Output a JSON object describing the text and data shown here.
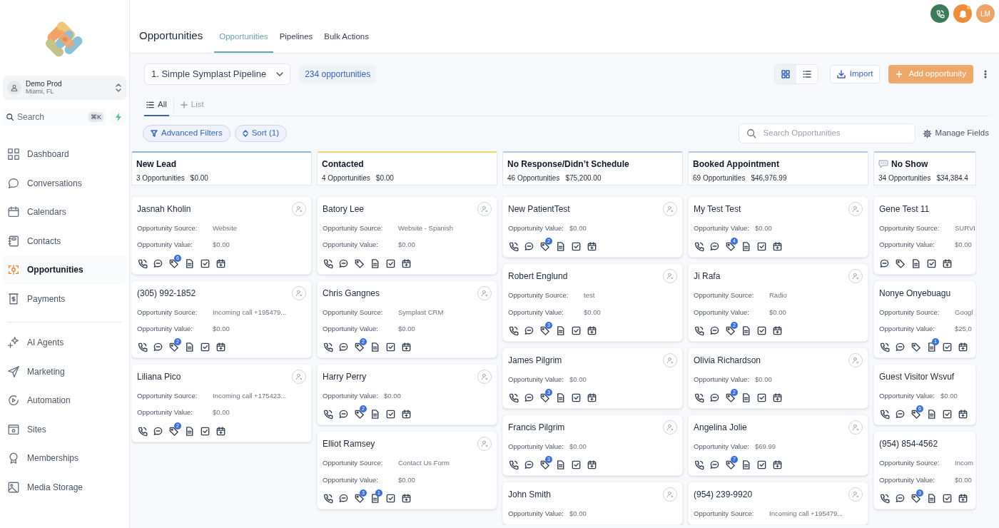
{
  "sidebar": {
    "account": {
      "name": "Demo Prod",
      "location": "Miami, FL"
    },
    "search": {
      "placeholder": "Search",
      "shortcut": "⌘K"
    },
    "nav_groups": [
      [
        {
          "label": "Dashboard",
          "selected": false
        },
        {
          "label": "Conversations",
          "selected": false
        },
        {
          "label": "Calendars",
          "selected": false
        },
        {
          "label": "Contacts",
          "selected": false
        },
        {
          "label": "Opportunities",
          "selected": true
        },
        {
          "label": "Payments",
          "selected": false
        }
      ],
      [
        {
          "label": "AI Agents",
          "selected": false
        },
        {
          "label": "Marketing",
          "selected": false
        },
        {
          "label": "Automation",
          "selected": false
        },
        {
          "label": "Sites",
          "selected": false
        },
        {
          "label": "Memberships",
          "selected": false
        },
        {
          "label": "Media Storage",
          "selected": false
        }
      ]
    ]
  },
  "topbar": {
    "avatar": "LM",
    "notification_dot": true
  },
  "header": {
    "title": "Opportunities",
    "tabs": [
      {
        "label": "Opportunities",
        "selected": true
      },
      {
        "label": "Pipelines",
        "selected": false
      },
      {
        "label": "Bulk Actions",
        "selected": false
      }
    ]
  },
  "toolbar": {
    "pipeline": "1. Simple Symplast Pipeline",
    "count": "234 opportunities",
    "views": [
      {
        "kind": "grid",
        "selected": true
      },
      {
        "kind": "list",
        "selected": false
      }
    ],
    "import": "Import",
    "add": "Add opportunity"
  },
  "view_tabs": [
    {
      "label": "All",
      "kind": "list",
      "selected": true
    },
    {
      "label": "List",
      "kind": "add",
      "selected": false
    }
  ],
  "filters": {
    "advanced": "Advanced Filters",
    "sort": "Sort (1)",
    "search_placeholder": "Search Opportunities",
    "manage": "Manage Fields"
  },
  "columns": [
    {
      "title": "New Lead",
      "count": "3 Opportunities",
      "amount": "$0.00",
      "color": "#8fb3d9",
      "emoji": false,
      "cards": [
        {
          "name": "Jasnah Kholin",
          "source_label": "Opportunity Source:",
          "source": "Website",
          "value_label": "Opportunity Value:",
          "value": "$0.00",
          "actions": [
            {
              "kind": "phone"
            },
            {
              "kind": "chat"
            },
            {
              "kind": "tag",
              "badge": "6"
            },
            {
              "kind": "note"
            },
            {
              "kind": "task"
            },
            {
              "kind": "calendar"
            }
          ]
        },
        {
          "name": "(305) 992-1852",
          "source_label": "Opportunity Source:",
          "source": "Incoming call +195479...",
          "value_label": "Opportunity Value:",
          "value": "$0.00",
          "actions": [
            {
              "kind": "phone"
            },
            {
              "kind": "chat"
            },
            {
              "kind": "tag",
              "badge": "2"
            },
            {
              "kind": "note"
            },
            {
              "kind": "task"
            },
            {
              "kind": "calendar"
            }
          ]
        },
        {
          "name": "Liliana Pico",
          "source_label": "Opportunity Source:",
          "source": "Incoming call +175423...",
          "value_label": "Opportunity Value:",
          "value": "$0.00",
          "actions": [
            {
              "kind": "phone"
            },
            {
              "kind": "chat"
            },
            {
              "kind": "tag",
              "badge": "2"
            },
            {
              "kind": "note"
            },
            {
              "kind": "task"
            },
            {
              "kind": "calendar"
            }
          ]
        }
      ]
    },
    {
      "title": "Contacted",
      "count": "4 Opportunities",
      "amount": "$0.00",
      "color": "#f2d27a",
      "emoji": false,
      "cards": [
        {
          "name": "Batory Lee",
          "source_label": "Opportunity Source:",
          "source": "Website - Spanish",
          "value_label": "Opportunity Value:",
          "value": "$0.00",
          "actions": [
            {
              "kind": "phone"
            },
            {
              "kind": "chat"
            },
            {
              "kind": "tag"
            },
            {
              "kind": "note"
            },
            {
              "kind": "task"
            },
            {
              "kind": "calendar"
            }
          ]
        },
        {
          "name": "Chris Gangnes",
          "source_label": "Opportunity Source:",
          "source": "Symplast CRM",
          "value_label": "Opportunity Value:",
          "value": "$0.00",
          "actions": [
            {
              "kind": "phone"
            },
            {
              "kind": "chat"
            },
            {
              "kind": "tag",
              "badge": "2"
            },
            {
              "kind": "note"
            },
            {
              "kind": "task"
            },
            {
              "kind": "calendar"
            }
          ]
        },
        {
          "name": "Harry Perry",
          "value_label": "Opportunity Value:",
          "value": "$0.00",
          "actions": [
            {
              "kind": "phone"
            },
            {
              "kind": "chat"
            },
            {
              "kind": "tag",
              "badge": "2"
            },
            {
              "kind": "note"
            },
            {
              "kind": "task"
            },
            {
              "kind": "calendar"
            }
          ]
        },
        {
          "name": "Elliot Ramsey",
          "source_label": "Opportunity Source:",
          "source": "Contact Us Form",
          "value_label": "Opportunity Value:",
          "value": "$0.00",
          "actions": [
            {
              "kind": "phone"
            },
            {
              "kind": "chat"
            },
            {
              "kind": "tag",
              "badge": "3"
            },
            {
              "kind": "note",
              "badge": "1"
            },
            {
              "kind": "task"
            },
            {
              "kind": "calendar"
            }
          ]
        }
      ]
    },
    {
      "title": "No Response/Didn’t Schedule",
      "count": "46 Opportunities",
      "amount": "$75,200.00",
      "color": "#b7c9e6",
      "emoji": false,
      "cards": [
        {
          "name": "New PatientTest",
          "value_label": "Opportunity Value:",
          "value": "$0.00",
          "actions": [
            {
              "kind": "phone"
            },
            {
              "kind": "chat"
            },
            {
              "kind": "tag",
              "badge": "2"
            },
            {
              "kind": "note"
            },
            {
              "kind": "task"
            },
            {
              "kind": "calendar"
            }
          ]
        },
        {
          "name": "Robert Englund",
          "source_label": "Opportunity Source:",
          "source": "test",
          "value_label": "Opportunity Value:",
          "value": "$0.00",
          "actions": [
            {
              "kind": "phone"
            },
            {
              "kind": "chat"
            },
            {
              "kind": "tag",
              "badge": "3"
            },
            {
              "kind": "note"
            },
            {
              "kind": "task"
            },
            {
              "kind": "calendar"
            }
          ]
        },
        {
          "name": "James Pilgrim",
          "value_label": "Opportunity Value:",
          "value": "$0.00",
          "actions": [
            {
              "kind": "phone"
            },
            {
              "kind": "chat"
            },
            {
              "kind": "tag",
              "badge": "3"
            },
            {
              "kind": "note"
            },
            {
              "kind": "task"
            },
            {
              "kind": "calendar"
            }
          ]
        },
        {
          "name": "Francis Pilgrim",
          "value_label": "Opportunity Value:",
          "value": "$0.00",
          "actions": [
            {
              "kind": "phone"
            },
            {
              "kind": "chat"
            },
            {
              "kind": "tag",
              "badge": "3"
            },
            {
              "kind": "note"
            },
            {
              "kind": "task"
            },
            {
              "kind": "calendar"
            }
          ]
        },
        {
          "name": "John Smith",
          "value_label": "Opportunity Value:",
          "value": "$0.00"
        }
      ]
    },
    {
      "title": "Booked Appointment",
      "count": "69 Opportunities",
      "amount": "$46,976.99",
      "color": "#b7c9e6",
      "emoji": false,
      "cards": [
        {
          "name": "My Test Test",
          "value_label": "Opportunity Value:",
          "value": "$0.00",
          "actions": [
            {
              "kind": "phone"
            },
            {
              "kind": "chat"
            },
            {
              "kind": "tag",
              "badge": "4"
            },
            {
              "kind": "note"
            },
            {
              "kind": "task"
            },
            {
              "kind": "calendar"
            }
          ]
        },
        {
          "name": "Ji Rafa",
          "source_label": "Opportunity Source:",
          "source": "Radio",
          "value_label": "Opportunity Value:",
          "value": "$0.00",
          "actions": [
            {
              "kind": "phone"
            },
            {
              "kind": "chat"
            },
            {
              "kind": "tag",
              "badge": "2"
            },
            {
              "kind": "note"
            },
            {
              "kind": "task"
            },
            {
              "kind": "calendar"
            }
          ]
        },
        {
          "name": "Olivia Richardson",
          "value_label": "Opportunity Value:",
          "value": "$0.00",
          "actions": [
            {
              "kind": "phone"
            },
            {
              "kind": "chat"
            },
            {
              "kind": "tag",
              "badge": "2"
            },
            {
              "kind": "note"
            },
            {
              "kind": "task"
            },
            {
              "kind": "calendar"
            }
          ]
        },
        {
          "name": "Angelina Jolie",
          "value_label": "Opportunity Value:",
          "value": "$69.99",
          "actions": [
            {
              "kind": "phone"
            },
            {
              "kind": "chat"
            },
            {
              "kind": "tag",
              "badge": "7"
            },
            {
              "kind": "note"
            },
            {
              "kind": "task"
            },
            {
              "kind": "calendar"
            }
          ]
        },
        {
          "name": "(954) 239-9920",
          "source_label": "Opportunity Source:",
          "source": "Incoming call +195479..."
        }
      ]
    },
    {
      "title": "No Show",
      "count": "34 Opportunities",
      "amount": "$34,384.4",
      "color": "#b7c9e6",
      "emoji": true,
      "cards": [
        {
          "name": "Gene Test 11",
          "source_label": "Opportunity Source:",
          "source": "SURVI",
          "value_label": "Opportunity Value:",
          "value": "$0.00",
          "actions": [
            {
              "kind": "chat"
            },
            {
              "kind": "tag"
            },
            {
              "kind": "note"
            },
            {
              "kind": "task"
            },
            {
              "kind": "calendar"
            }
          ]
        },
        {
          "name": "Nonye Onyebuagu",
          "source_label": "Opportunity Source:",
          "source": "Googl",
          "value_label": "Opportunity Value:",
          "value": "$25,0",
          "actions": [
            {
              "kind": "phone"
            },
            {
              "kind": "chat"
            },
            {
              "kind": "tag"
            },
            {
              "kind": "note",
              "badge": "1"
            },
            {
              "kind": "task"
            },
            {
              "kind": "calendar"
            }
          ]
        },
        {
          "name": "Guest Visitor Wsvuf",
          "value_label": "Opportunity Value:",
          "value": "$0.00",
          "actions": [
            {
              "kind": "phone"
            },
            {
              "kind": "chat"
            },
            {
              "kind": "tag",
              "badge": "6"
            },
            {
              "kind": "note"
            },
            {
              "kind": "task"
            },
            {
              "kind": "calendar"
            }
          ]
        },
        {
          "name": "(954) 854-4562",
          "source_label": "Opportunity Source:",
          "source": "Incom",
          "value_label": "Opportunity Value:",
          "value": "$0.00",
          "actions": [
            {
              "kind": "phone"
            },
            {
              "kind": "chat"
            },
            {
              "kind": "tag",
              "badge": "3"
            },
            {
              "kind": "note"
            },
            {
              "kind": "task"
            },
            {
              "kind": "calendar"
            }
          ]
        }
      ]
    }
  ]
}
